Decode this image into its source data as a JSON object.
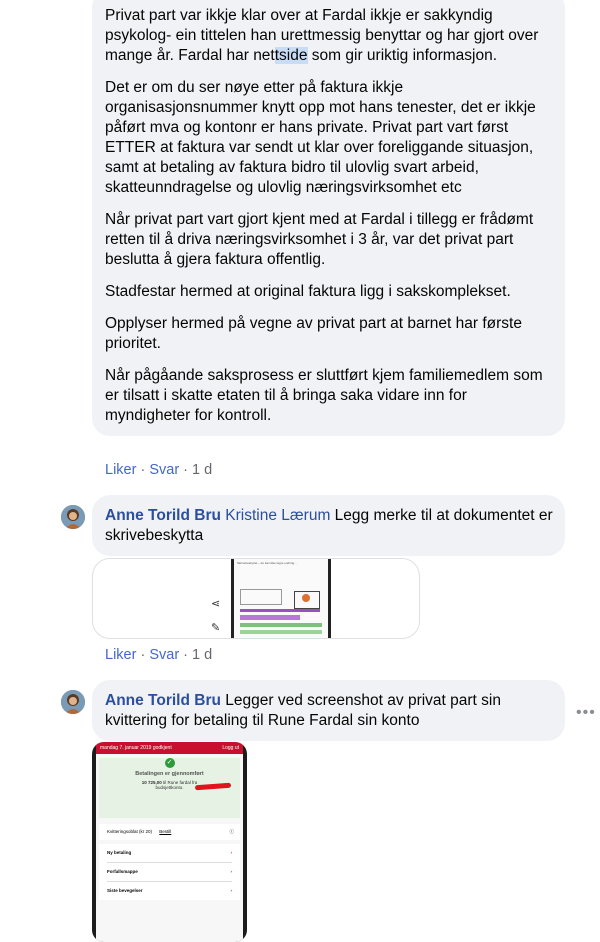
{
  "comment1": {
    "paragraphs": [
      "Privat part var ikkje klar over at Fardal ikkje er sakkyndig psykolog- ein tittelen han urettmessig benyttar og har gjort over mange år. Fardal har net",
      "Det er om du ser nøye etter på faktura ikkje organisasjonsnummer knytt opp mot hans tenester, det er ikkje påført mva og kontonr er hans private. Privat part vart først ETTER at faktura var sendt ut klar over foreliggande situasjon, samt at betaling av faktura bidro til ulovlig svart arbeid, skatteunndragelse og ulovlig næringsvirksomhet etc",
      "Når privat part vart gjort kjent med at Fardal i tillegg er frådømt retten til å driva næringsvirksomhet i 3 år, var det privat part beslutta å gjera faktura offentlig.",
      "Stadfestar hermed at original faktura ligg i sakskomplekset.",
      "Opplyser hermed på vegne av privat part at barnet har første prioritet.",
      "Når pågåande saksprosess er sluttført kjem familiemedlem som er tilsatt i skatte etaten til å bringa saka vidare inn for myndigheter for kontroll."
    ],
    "p1_highlight": "tside",
    "p1_rest": " som gir uriktig informasjon."
  },
  "actions": {
    "like": "Liker",
    "sep": " · ",
    "reply": "Svar",
    "time": "1 d"
  },
  "comment2": {
    "author": "Anne Torild Bru",
    "mention": "Kristine Lærum",
    "text": " Legg merke til at dokumentet er skrivebeskytta",
    "thumb_header": "Skrivebeskyttet – du kan ikke lagre endring..."
  },
  "comment3": {
    "author": "Anne Torild Bru",
    "text": " Legger ved screenshot av privat part sin kvittering for betaling til Rune Fardal sin konto"
  },
  "receipt": {
    "topbar": "mandag 7. januar 2019 godkjent",
    "logout": "Logg ut",
    "title": "Betalingen er gjennomført",
    "amount": "10 725,00",
    "amount_text": " til Rune fardal fra",
    "account": "budsjettkonto.",
    "row1": "Kvitteringsoblat (kr 20)",
    "row1_link": "Bestill",
    "menu": [
      "Ny betaling",
      "Forfallsmappe",
      "Siste bevegelser"
    ]
  },
  "colors": {
    "bubble": "#f0f2f5",
    "link": "#2b4f9e",
    "receipt_red": "#c8102e",
    "receipt_green": "#2e9b3a"
  }
}
